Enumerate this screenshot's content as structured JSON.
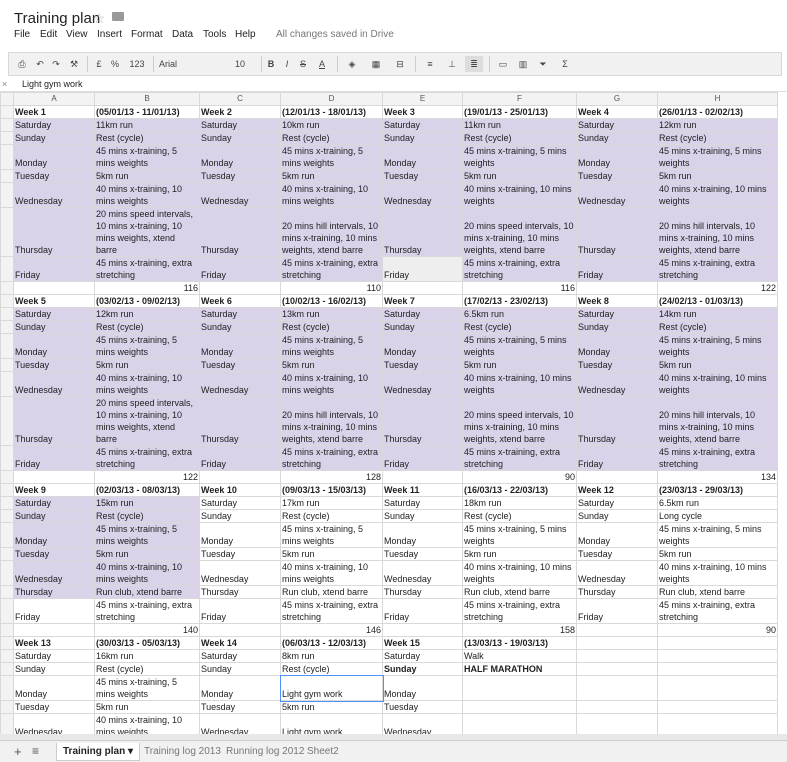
{
  "app": {
    "title": "Training plan",
    "save_status": "All changes saved in Drive"
  },
  "menu": [
    "File",
    "Edit",
    "View",
    "Insert",
    "Format",
    "Data",
    "Tools",
    "Help"
  ],
  "toolbar": {
    "currency": "£",
    "percent": "%",
    "number_format": "123",
    "font": "Arial",
    "font_size": "10",
    "bold": "B",
    "italic": "I",
    "strike": "S",
    "text_color": "A",
    "sum": "Σ"
  },
  "formula_bar": {
    "content": "Light gym work"
  },
  "colors": {
    "highlight": "#d9d2e9",
    "grey": "#eeeeee"
  },
  "columns": [
    "A",
    "B",
    "C",
    "D",
    "E",
    "F",
    "G",
    "H"
  ],
  "active_column": "D",
  "sheet": [
    [
      [
        "Week 1",
        "b"
      ],
      [
        "(05/01/13 - 11/01/13)",
        "b"
      ],
      [
        "Week 2",
        "b"
      ],
      [
        "(12/01/13 - 18/01/13)",
        "b"
      ],
      [
        "Week 3",
        "b"
      ],
      [
        "(19/01/13 - 25/01/13)",
        "b"
      ],
      [
        "Week 4",
        "b"
      ],
      [
        "(26/01/13 - 02/02/13)",
        "b"
      ]
    ],
    [
      [
        "Saturday",
        "hl"
      ],
      [
        "11km run",
        "hl"
      ],
      [
        "Saturday",
        "hl"
      ],
      [
        "10km run",
        "hl"
      ],
      [
        "Saturday",
        "hl"
      ],
      [
        "11km run",
        "hl"
      ],
      [
        "Saturday",
        "hl"
      ],
      [
        "12km run",
        "hl"
      ]
    ],
    [
      [
        "Sunday",
        "hl"
      ],
      [
        "Rest (cycle)",
        "hl"
      ],
      [
        "Sunday",
        "hl"
      ],
      [
        "Rest (cycle)",
        "hl"
      ],
      [
        "Sunday",
        "hl"
      ],
      [
        "Rest (cycle)",
        "hl"
      ],
      [
        "Sunday",
        "hl"
      ],
      [
        "Rest (cycle)",
        "hl"
      ]
    ],
    [
      [
        "Monday",
        "hl"
      ],
      [
        "45 mins x-training, 5 mins weights",
        "hl"
      ],
      [
        "Monday",
        "hl"
      ],
      [
        "45 mins x-training, 5 mins weights",
        "hl"
      ],
      [
        "Monday",
        "hl"
      ],
      [
        "45 mins x-training, 5 mins weights",
        "hl"
      ],
      [
        "Monday",
        "hl"
      ],
      [
        "45 mins x-training, 5 mins weights",
        "hl"
      ]
    ],
    [
      [
        "Tuesday",
        "hl"
      ],
      [
        "5km run",
        "hl"
      ],
      [
        "Tuesday",
        "hl"
      ],
      [
        "5km run",
        "hl"
      ],
      [
        "Tuesday",
        "hl"
      ],
      [
        "5km run",
        "hl"
      ],
      [
        "Tuesday",
        "hl"
      ],
      [
        "5km run",
        "hl"
      ]
    ],
    [
      [
        "Wednesday",
        "hl"
      ],
      [
        "40 mins x-training, 10 mins weights",
        "hl"
      ],
      [
        "Wednesday",
        "hl"
      ],
      [
        "40 mins x-training, 10 mins weights",
        "hl"
      ],
      [
        "Wednesday",
        "hl"
      ],
      [
        "40 mins x-training, 10 mins weights",
        "hl"
      ],
      [
        "Wednesday",
        "hl"
      ],
      [
        "40 mins x-training, 10 mins weights",
        "hl"
      ]
    ],
    [
      [
        "Thursday",
        "hl"
      ],
      [
        "20 mins speed intervals, 10 mins x-training, 10 mins weights, xtend barre",
        "hl"
      ],
      [
        "Thursday",
        "hl"
      ],
      [
        "20 mins hill intervals, 10 mins x-training, 10 mins weights, xtend barre",
        "hl"
      ],
      [
        "Thursday",
        "hl"
      ],
      [
        "20 mins speed intervals, 10 mins x-training, 10 mins weights, xtend barre",
        "hl"
      ],
      [
        "Thursday",
        "hl"
      ],
      [
        "20 mins hill intervals, 10 mins x-training, 10 mins weights, xtend barre",
        "hl"
      ]
    ],
    [
      [
        "Friday",
        "hl"
      ],
      [
        "45 mins x-training, extra stretching",
        "hl"
      ],
      [
        "Friday",
        "hl"
      ],
      [
        "45 mins x-training, extra stretching",
        "hl"
      ],
      [
        "Friday",
        "grey"
      ],
      [
        "45 mins x-training, extra stretching",
        "hl"
      ],
      [
        "Friday",
        "hl"
      ],
      [
        "45 mins x-training, extra stretching",
        "hl"
      ]
    ],
    [
      [
        "",
        ""
      ],
      [
        "116",
        "num"
      ],
      [
        "",
        ""
      ],
      [
        "110",
        "num"
      ],
      [
        "",
        ""
      ],
      [
        "116",
        "num"
      ],
      [
        "",
        ""
      ],
      [
        "122",
        "num"
      ]
    ],
    [
      [
        "Week 5",
        "b"
      ],
      [
        "(03/02/13 - 09/02/13)",
        "b"
      ],
      [
        "Week 6",
        "b"
      ],
      [
        "(10/02/13 - 16/02/13)",
        "b"
      ],
      [
        "Week 7",
        "b"
      ],
      [
        "(17/02/13 - 23/02/13)",
        "b"
      ],
      [
        "Week 8",
        "b"
      ],
      [
        "(24/02/13 - 01/03/13)",
        "b"
      ]
    ],
    [
      [
        "Saturday",
        "hl"
      ],
      [
        "12km run",
        "hl"
      ],
      [
        "Saturday",
        "hl"
      ],
      [
        "13km run",
        "hl"
      ],
      [
        "Saturday",
        "hl"
      ],
      [
        "6.5km run",
        "hl"
      ],
      [
        "Saturday",
        "hl"
      ],
      [
        "14km run",
        "hl"
      ]
    ],
    [
      [
        "Sunday",
        "hl"
      ],
      [
        "Rest (cycle)",
        "hl"
      ],
      [
        "Sunday",
        "hl"
      ],
      [
        "Rest (cycle)",
        "hl"
      ],
      [
        "Sunday",
        "hl"
      ],
      [
        "Rest (cycle)",
        "hl"
      ],
      [
        "Sunday",
        "hl"
      ],
      [
        "Rest (cycle)",
        "hl"
      ]
    ],
    [
      [
        "Monday",
        "hl"
      ],
      [
        "45 mins x-training, 5 mins weights",
        "hl"
      ],
      [
        "Monday",
        "hl"
      ],
      [
        "45 mins x-training, 5 mins weights",
        "hl"
      ],
      [
        "Monday",
        "hl"
      ],
      [
        "45 mins x-training, 5 mins weights",
        "hl"
      ],
      [
        "Monday",
        "hl"
      ],
      [
        "45 mins x-training, 5 mins weights",
        "hl"
      ]
    ],
    [
      [
        "Tuesday",
        "hl"
      ],
      [
        "5km run",
        "hl"
      ],
      [
        "Tuesday",
        "hl"
      ],
      [
        "5km run",
        "hl"
      ],
      [
        "Tuesday",
        "hl"
      ],
      [
        "5km run",
        "hl"
      ],
      [
        "Tuesday",
        "hl"
      ],
      [
        "5km run",
        "hl"
      ]
    ],
    [
      [
        "Wednesday",
        "hl"
      ],
      [
        "40 mins x-training, 10 mins weights",
        "hl"
      ],
      [
        "Wednesday",
        "hl"
      ],
      [
        "40 mins x-training, 10 mins weights",
        "hl"
      ],
      [
        "Wednesday",
        "hl"
      ],
      [
        "40 mins x-training, 10 mins weights",
        "hl"
      ],
      [
        "Wednesday",
        "hl"
      ],
      [
        "40 mins x-training, 10 mins weights",
        "hl"
      ]
    ],
    [
      [
        "Thursday",
        "hl"
      ],
      [
        "20 mins speed intervals, 10 mins x-training, 10 mins weights, xtend barre",
        "hl"
      ],
      [
        "Thursday",
        "hl"
      ],
      [
        "20 mins hill intervals, 10 mins x-training, 10 mins weights, xtend barre",
        "hl"
      ],
      [
        "Thursday",
        "hl"
      ],
      [
        "20 mins speed intervals, 10 mins x-training, 10 mins weights, xtend barre",
        "hl"
      ],
      [
        "Thursday",
        "hl"
      ],
      [
        "20 mins hill intervals, 10 mins x-training, 10 mins weights, xtend barre",
        "hl"
      ]
    ],
    [
      [
        "Friday",
        "hl"
      ],
      [
        "45 mins x-training, extra stretching",
        "hl"
      ],
      [
        "Friday",
        "hl"
      ],
      [
        "45 mins x-training, extra stretching",
        "hl"
      ],
      [
        "Friday",
        "hl"
      ],
      [
        "45 mins x-training, extra stretching",
        "hl"
      ],
      [
        "Friday",
        "hl"
      ],
      [
        "45 mins x-training, extra stretching",
        "hl"
      ]
    ],
    [
      [
        "",
        ""
      ],
      [
        "122",
        "num"
      ],
      [
        "",
        ""
      ],
      [
        "128",
        "num"
      ],
      [
        "",
        ""
      ],
      [
        "90",
        "num"
      ],
      [
        "",
        ""
      ],
      [
        "134",
        "num"
      ]
    ],
    [
      [
        "Week 9",
        "b"
      ],
      [
        "(02/03/13 - 08/03/13)",
        "b"
      ],
      [
        "Week 10",
        "b"
      ],
      [
        "(09/03/13 - 15/03/13)",
        "b"
      ],
      [
        "Week 11",
        "b"
      ],
      [
        "(16/03/13 - 22/03/13)",
        "b"
      ],
      [
        "Week 12",
        "b"
      ],
      [
        "(23/03/13 - 29/03/13)",
        "b"
      ]
    ],
    [
      [
        "Saturday",
        "hl"
      ],
      [
        "15km run",
        "hl"
      ],
      [
        "Saturday",
        ""
      ],
      [
        "17km run",
        ""
      ],
      [
        "Saturday",
        ""
      ],
      [
        "18km run",
        ""
      ],
      [
        "Saturday",
        ""
      ],
      [
        "6.5km run",
        ""
      ]
    ],
    [
      [
        "Sunday",
        "hl"
      ],
      [
        "Rest (cycle)",
        "hl"
      ],
      [
        "Sunday",
        ""
      ],
      [
        "Rest (cycle)",
        ""
      ],
      [
        "Sunday",
        ""
      ],
      [
        "Rest (cycle)",
        ""
      ],
      [
        "Sunday",
        ""
      ],
      [
        "Long cycle",
        ""
      ]
    ],
    [
      [
        "Monday",
        "hl"
      ],
      [
        "45 mins x-training, 5 mins weights",
        "hl"
      ],
      [
        "Monday",
        ""
      ],
      [
        "45 mins x-training, 5 mins weights",
        ""
      ],
      [
        "Monday",
        ""
      ],
      [
        "45 mins x-training, 5 mins weights",
        ""
      ],
      [
        "Monday",
        ""
      ],
      [
        "45 mins x-training, 5 mins weights",
        ""
      ]
    ],
    [
      [
        "Tuesday",
        "hl"
      ],
      [
        "5km run",
        "hl"
      ],
      [
        "Tuesday",
        ""
      ],
      [
        "5km run",
        ""
      ],
      [
        "Tuesday",
        ""
      ],
      [
        "5km run",
        ""
      ],
      [
        "Tuesday",
        ""
      ],
      [
        "5km run",
        ""
      ]
    ],
    [
      [
        "Wednesday",
        "hl"
      ],
      [
        "40 mins x-training, 10 mins weights",
        "hl"
      ],
      [
        "Wednesday",
        ""
      ],
      [
        "40 mins x-training, 10 mins weights",
        ""
      ],
      [
        "Wednesday",
        ""
      ],
      [
        "40 mins x-training, 10 mins weights",
        ""
      ],
      [
        "Wednesday",
        ""
      ],
      [
        "40 mins x-training, 10 mins weights",
        ""
      ]
    ],
    [
      [
        "Thursday",
        "hl"
      ],
      [
        "Run club, xtend barre",
        "hl"
      ],
      [
        "Thursday",
        ""
      ],
      [
        "Run club, xtend barre",
        ""
      ],
      [
        "Thursday",
        ""
      ],
      [
        "Run club, xtend barre",
        ""
      ],
      [
        "Thursday",
        ""
      ],
      [
        "Run club, xtend barre",
        ""
      ]
    ],
    [
      [
        "Friday",
        ""
      ],
      [
        "45 mins x-training, extra stretching",
        ""
      ],
      [
        "Friday",
        ""
      ],
      [
        "45 mins x-training, extra stretching",
        ""
      ],
      [
        "Friday",
        ""
      ],
      [
        "45 mins x-training, extra stretching",
        ""
      ],
      [
        "Friday",
        ""
      ],
      [
        "45 mins x-training, extra stretching",
        ""
      ]
    ],
    [
      [
        "",
        ""
      ],
      [
        "140",
        "num"
      ],
      [
        "",
        ""
      ],
      [
        "146",
        "num"
      ],
      [
        "",
        ""
      ],
      [
        "158",
        "num"
      ],
      [
        "",
        ""
      ],
      [
        "90",
        "num"
      ]
    ],
    [
      [
        "Week 13",
        "b"
      ],
      [
        "(30/03/13 - 05/03/13)",
        "b"
      ],
      [
        "Week 14",
        "b"
      ],
      [
        "(06/03/13 - 12/03/13)",
        "b"
      ],
      [
        "Week 15",
        "b"
      ],
      [
        "(13/03/13 - 19/03/13)",
        "b"
      ],
      [
        "",
        ""
      ],
      [
        "",
        ""
      ]
    ],
    [
      [
        "Saturday",
        ""
      ],
      [
        "16km run",
        ""
      ],
      [
        "Saturday",
        ""
      ],
      [
        "8km run",
        ""
      ],
      [
        "Saturday",
        ""
      ],
      [
        "Walk",
        ""
      ],
      [
        "",
        ""
      ],
      [
        "",
        ""
      ]
    ],
    [
      [
        "Sunday",
        ""
      ],
      [
        "Rest (cycle)",
        ""
      ],
      [
        "Sunday",
        ""
      ],
      [
        "Rest (cycle)",
        ""
      ],
      [
        "Sunday",
        "b"
      ],
      [
        "HALF MARATHON",
        "b"
      ],
      [
        "",
        ""
      ],
      [
        "",
        ""
      ]
    ],
    [
      [
        "Monday",
        ""
      ],
      [
        "45 mins x-training, 5 mins weights",
        ""
      ],
      [
        "Monday",
        ""
      ],
      [
        "Light gym work",
        ""
      ],
      [
        "Monday",
        ""
      ],
      [
        "",
        ""
      ],
      [
        "",
        ""
      ],
      [
        "",
        ""
      ]
    ],
    [
      [
        "Tuesday",
        ""
      ],
      [
        "5km run",
        ""
      ],
      [
        "Tuesday",
        ""
      ],
      [
        "5km run",
        ""
      ],
      [
        "Tuesday",
        ""
      ],
      [
        "",
        ""
      ],
      [
        "",
        ""
      ],
      [
        "",
        ""
      ]
    ],
    [
      [
        "Wednesday",
        ""
      ],
      [
        "40 mins x-training, 10 mins weights",
        ""
      ],
      [
        "Wednesday",
        ""
      ],
      [
        "Light gym work",
        ""
      ],
      [
        "Wednesday",
        ""
      ],
      [
        "",
        ""
      ],
      [
        "",
        ""
      ],
      [
        "",
        ""
      ]
    ]
  ],
  "tabs": [
    "Training plan",
    "Training log 2013",
    "Running log 2012",
    "Sheet2"
  ]
}
